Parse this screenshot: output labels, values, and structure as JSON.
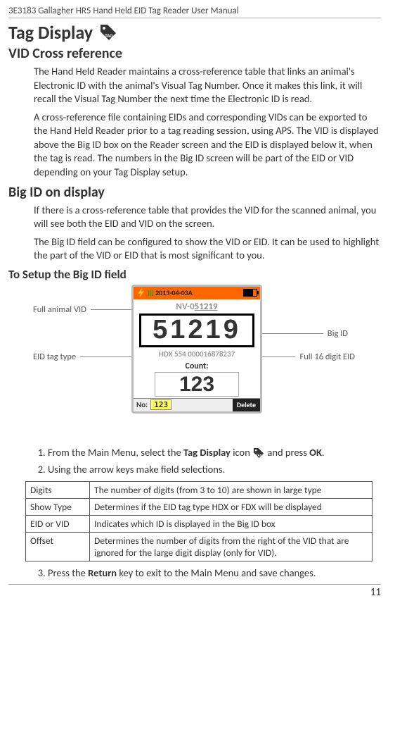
{
  "header": "3E3183 Gallagher HR5 Hand Held EID Tag Reader User Manual",
  "title": "Tag Display",
  "section_vid": {
    "heading": "VID Cross reference",
    "p1": "The Hand Held Reader maintains a cross-reference table that links an animal's Electronic ID with the animal's Visual Tag Number. Once it makes this link, it will recall the Visual Tag Number the next time the Electronic ID is read.",
    "p2": "A cross-reference file containing EIDs and corresponding VIDs can be exported to the Hand Held Reader prior to a tag reading session, using APS. The VID is displayed above the Big ID box on the Reader screen and the EID is displayed below it, when the tag is read. The numbers in the Big ID screen will be part of the EID or VID depending on your Tag Display setup."
  },
  "section_bigid": {
    "heading": "Big ID on display",
    "p1": "If there is a cross-reference table that provides the VID for the scanned animal, you will see both the EID and VID on the screen.",
    "p2": "The Big ID field can be configured to show the VID or EID. It can be used to highlight the part of the VID or EID that is most significant to you."
  },
  "section_setup": {
    "heading": "To Setup the Big ID field"
  },
  "device": {
    "session": "2013-04-03A",
    "vid_prefix": "NV-0",
    "vid_suffix": "51219",
    "bigid": "51219",
    "eid_type": "HDX",
    "eid_mid": "554",
    "eid_rest": "000016878237",
    "count_label": "Count:",
    "count": "123",
    "no_label": "No:",
    "no_value": "123",
    "delete": "Delete"
  },
  "callouts": {
    "full_vid": "Full animal VID",
    "eid_type": "EID tag type",
    "big_id": "Big ID",
    "full_eid": "Full 16 digit EID"
  },
  "steps": {
    "s1a": "From the Main Menu, select the ",
    "s1b": "Tag Display",
    "s1c": " icon ",
    "s1d": " and press ",
    "s1e": "OK",
    "s1f": ".",
    "s2": "Using the arrow keys make field selections.",
    "s3a": "Press the ",
    "s3b": "Return",
    "s3c": " key to exit to the Main Menu and save changes."
  },
  "opts": {
    "row1": {
      "label": "Digits",
      "desc": "The number of digits (from 3 to 10) are shown in large type"
    },
    "row2": {
      "label": "Show Type",
      "desc": "Determines if the EID tag type HDX or FDX will be displayed"
    },
    "row3": {
      "label": "EID or VID",
      "desc": "Indicates which ID is displayed in the Big ID box"
    },
    "row4": {
      "label": "Offset",
      "desc": "Determines the number of digits from the right of the VID that are ignored for the large digit display (only for VID)."
    }
  },
  "page_number": "11"
}
